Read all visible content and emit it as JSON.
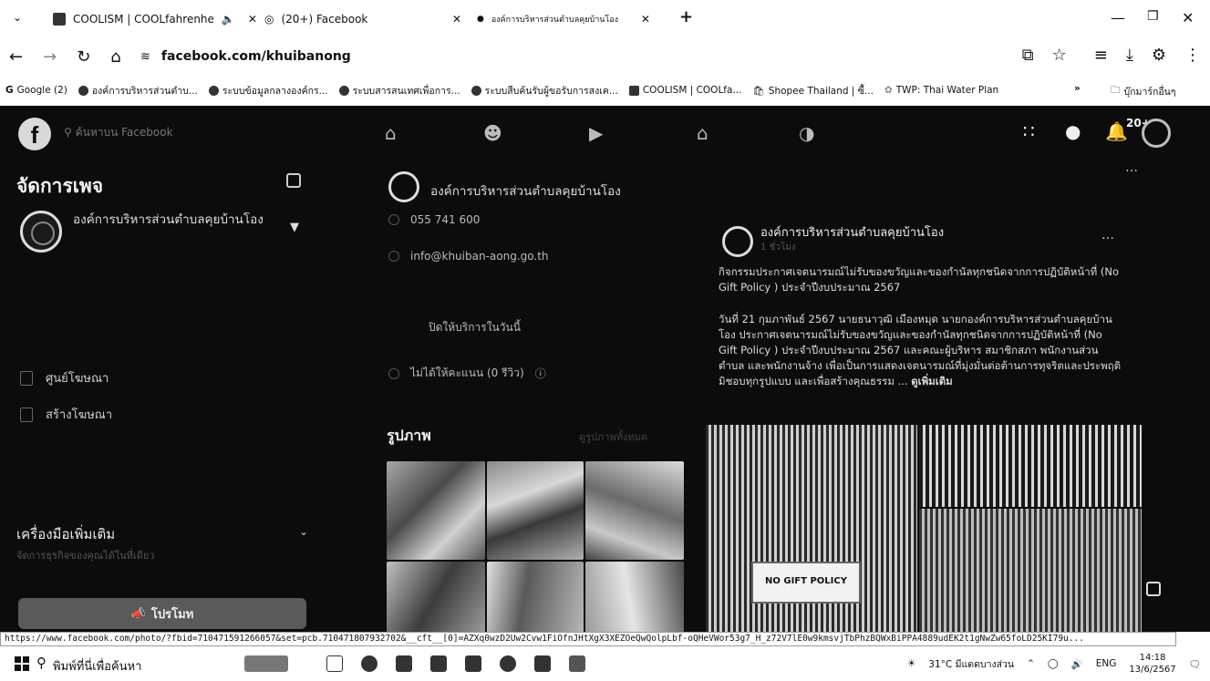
{
  "browser": {
    "tabs": [
      {
        "title": "COOLISM | COOLfahrenhe",
        "active": false
      },
      {
        "title": "(20+) Facebook",
        "active": true
      },
      {
        "title": "องค์การบริหารส่วนตำบลคุยบ้านโอง",
        "active": false
      }
    ],
    "url": "facebook.com/khuibanong",
    "bookmarks": [
      "Google (2)",
      "องค์การบริหารส่วนตำบ...",
      "ระบบข้อมูลกลางองค์กร...",
      "ระบบสารสนเทศเพื่อการ...",
      "ระบบสืบค้นรับผู้ขอรับการสงเค...",
      "COOLISM | COOLfa...",
      "Shopee Thailand | ซื้...",
      "TWP: Thai Water Plan",
      "บุ๊กมาร์กอื่นๆ"
    ]
  },
  "fb": {
    "search_placeholder": "ค้นหาบน Facebook",
    "notification_badge": "20+",
    "sidebar": {
      "title": "จัดการเพจ",
      "page_name": "องค์การบริหารส่วนตำบลคุยบ้านโอง",
      "items": [
        "ศูนย์โฆษณา",
        "สร้างโฆษณา"
      ],
      "tools_title": "เครื่องมือเพิ่มเติม",
      "tools_subtitle": "จัดการธุรกิจของคุณได้ในที่เดียว",
      "promote_label": "โปรโมท"
    },
    "intro": {
      "page_name": "องค์การบริหารส่วนตำบลคุยบ้านโอง",
      "phone": "055 741 600",
      "email": "info@khuiban-aong.go.th",
      "status": "ไม่ได้ให้คะแนน (0 รีวิว)",
      "hours_label": "ปิดให้บริการในวันนี้"
    },
    "photos": {
      "title": "รูปภาพ",
      "see_all": "ดูรูปภาพทั้งหมด"
    },
    "post": {
      "author": "องค์การบริหารส่วนตำบลคุยบ้านโอง",
      "time": "1 ชั่วโมง",
      "headline": "กิจกรรมประกาศเจตนารมณ์ไม่รับของขวัญและของกำนัลทุกชนิดจากการปฏิบัติหน้าที่ (No Gift Policy ) ประจำปีงบประมาณ 2567",
      "body": "วันที่ 21 กุมภาพันธ์ 2567 นายธนาวุฒิ เมืองหมุด นายกองค์การบริหารส่วนตำบลคุยบ้านโอง ประกาศเจตนารมณ์ไม่รับของขวัญและของกำนัลทุกชนิดจากการปฏิบัติหน้าที่ (No Gift Policy ) ประจำปีงบประมาณ 2567 และคณะผู้บริหาร สมาชิกสภา พนักงานส่วนตำบล และพนักงานจ้าง เพื่อเป็นการแสดงเจตนารมณ์ที่มุ่งมั่นต่อต้านการทุจริตและประพฤติมิชอบทุกรูปแบบ และเพื่อสร้างคุณธรรม ...",
      "see_more": "ดูเพิ่มเติม",
      "banner": "NO GIFT POLICY"
    }
  },
  "statusbar_url": "https://www.facebook.com/photo/?fbid=710471591266057&set=pcb.710471807932702&__cft__[0]=AZXq0wzD2Uw2Cvw1FiOfnJHtXgX3XEZOeQwQolpLbf-oQHeVWor53g7_H_z72V7lE0w9kmsvjTbPhzBQWxBiPPA4889udEK2t1gNwZw65foLD25KI79u...",
  "taskbar": {
    "search_placeholder": "พิมพ์ที่นี่เพื่อค้นหา",
    "weather": "31°C มีแดดบางส่วน",
    "lang": "ENG",
    "time": "14:18",
    "date": "13/6/2567"
  },
  "colors": {
    "fb_background": "#0c0c0c",
    "text": "#e8e8e8",
    "chrome": "#ffffff"
  }
}
